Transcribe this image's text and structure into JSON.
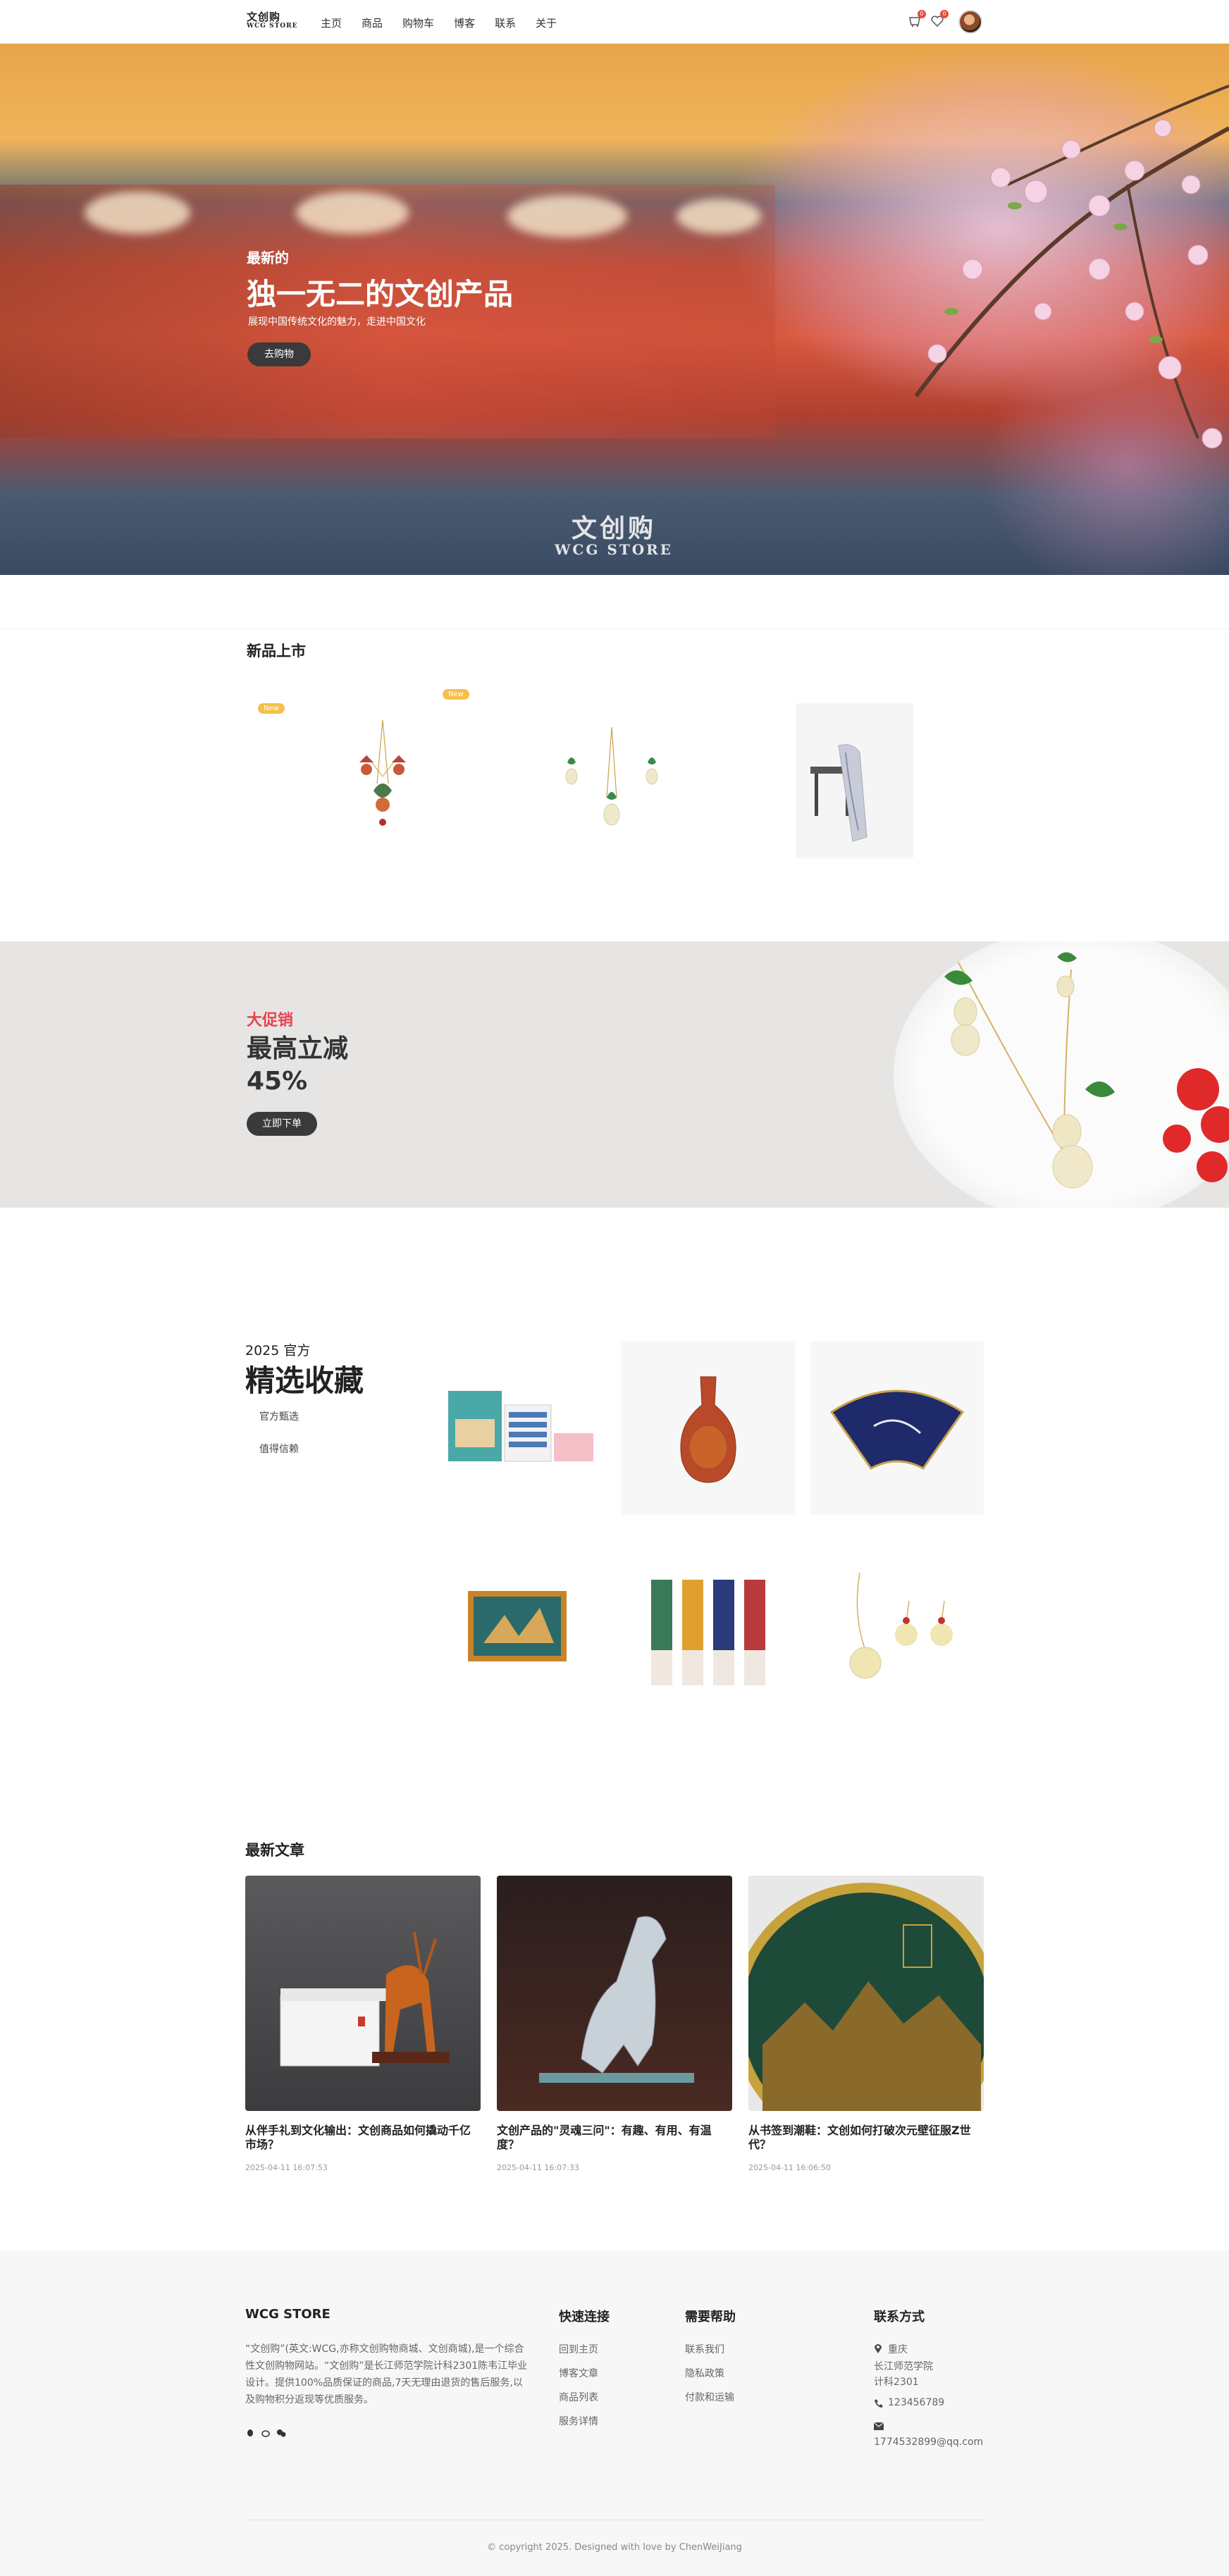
{
  "header": {
    "logo_top": "文创购",
    "logo_bottom": "WCG STORE",
    "nav": [
      "主页",
      "商品",
      "购物车",
      "博客",
      "联系",
      "关于"
    ],
    "cart_count": "0",
    "wishlist_count": "0"
  },
  "hero": {
    "subtitle": "最新的",
    "title": "独一无二的文创产品",
    "desc": "展现中国传统文化的魅力，走进中国文化",
    "button": "去购物",
    "logo_top": "文创购",
    "logo_bottom": "WCG STORE"
  },
  "new_products": {
    "title": "新品上市",
    "tag": "New"
  },
  "promo": {
    "label": "大促销",
    "line1": "最高立减",
    "line2": "45%",
    "button": "立即下单"
  },
  "collection": {
    "year": "2025 官方",
    "title": "精选收藏",
    "links": [
      "官方甄选",
      "值得信赖"
    ]
  },
  "articles": {
    "title": "最新文章",
    "items": [
      {
        "title": "从伴手礼到文化输出：文创商品如何撬动千亿市场？",
        "date": "2025-04-11 16:07:53"
      },
      {
        "title": "文创产品的\"灵魂三问\"：有趣、有用、有温度？",
        "date": "2025-04-11 16:07:33"
      },
      {
        "title": "从书签到潮鞋：文创如何打破次元壁征服Z世代？",
        "date": "2025-04-11 16:06:50"
      }
    ]
  },
  "footer": {
    "brand": "WCG STORE",
    "about": "“文创购”(英文:WCG,亦称文创购物商城、文创商城),是一个综合性文创购物网站。“文创购”是长江师范学院计科2301陈韦江毕业设计。提供100%品质保证的商品,7天无理由退货的售后服务,以及购物积分返现等优质服务。",
    "quick_title": "快速连接",
    "quick_links": [
      "回到主页",
      "博客文章",
      "商品列表",
      "服务详情"
    ],
    "help_title": "需要帮助",
    "help_links": [
      "联系我们",
      "隐私政策",
      "付款和运输"
    ],
    "contact_title": "联系方式",
    "address": [
      "重庆",
      "长江师范学院",
      "计科2301"
    ],
    "phone": "123456789",
    "email": "1774532899@qq.com",
    "copyright": "© copyright 2025. Designed with love by ChenWeiJiang"
  }
}
